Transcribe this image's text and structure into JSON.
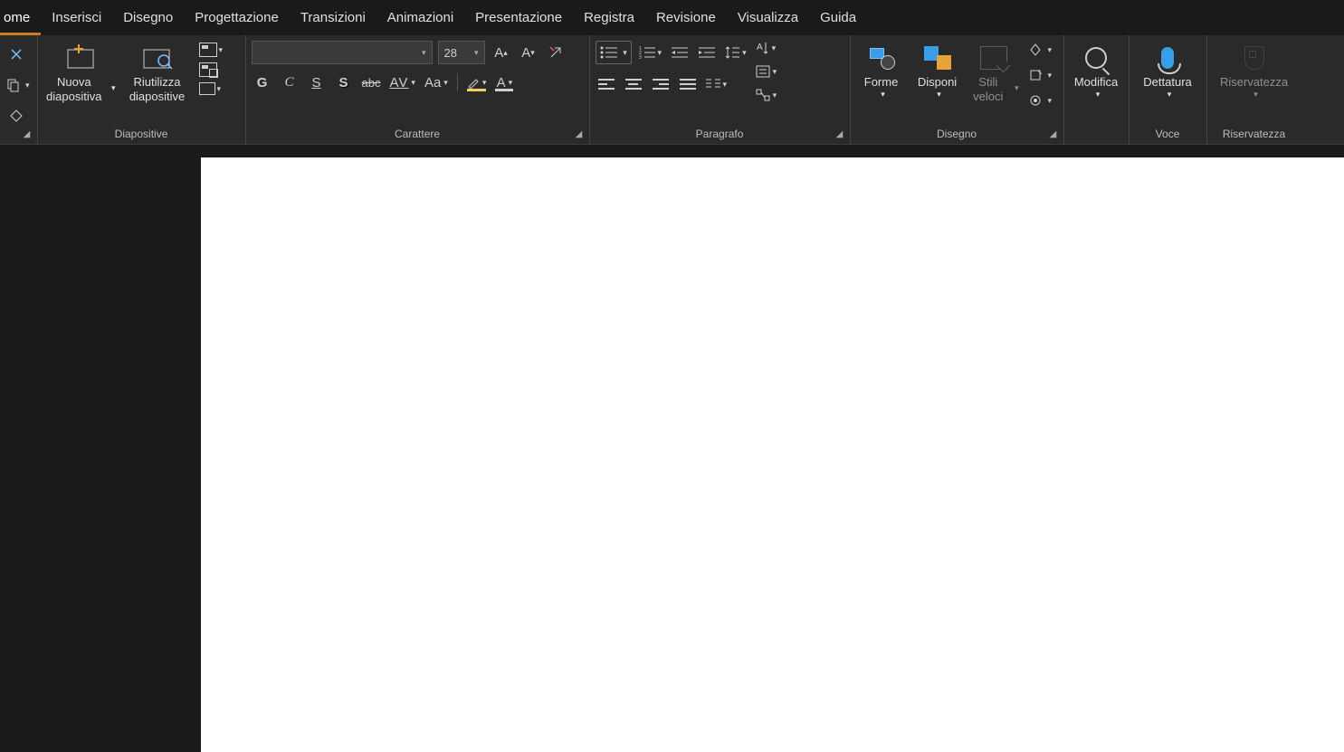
{
  "tabs": {
    "home": "ome",
    "inserisci": "Inserisci",
    "disegno": "Disegno",
    "progettazione": "Progettazione",
    "transizioni": "Transizioni",
    "animazioni": "Animazioni",
    "presentazione": "Presentazione",
    "registra": "Registra",
    "revisione": "Revisione",
    "visualizza": "Visualizza",
    "guida": "Guida"
  },
  "groups": {
    "diapositive": {
      "label": "Diapositive",
      "new_slide": "Nuova diapositiva",
      "reuse_slides": "Riutilizza diapositive"
    },
    "carattere": {
      "label": "Carattere",
      "font_name": "",
      "font_size": "28",
      "bold": "G",
      "italic": "C",
      "underline": "S",
      "shadow": "S",
      "strike": "abc",
      "spacing": "AV",
      "case": "Aa",
      "font_color_letter": "A"
    },
    "paragrafo": {
      "label": "Paragrafo"
    },
    "disegno": {
      "label": "Disegno",
      "forme": "Forme",
      "disponi": "Disponi",
      "stili": "Stili veloci"
    },
    "modifica": {
      "label": "Modifica"
    },
    "voce": {
      "label": "Voce",
      "dettatura": "Dettatura"
    },
    "riservatezza": {
      "label": "Riservatezza",
      "btn": "Riservatezza"
    }
  }
}
